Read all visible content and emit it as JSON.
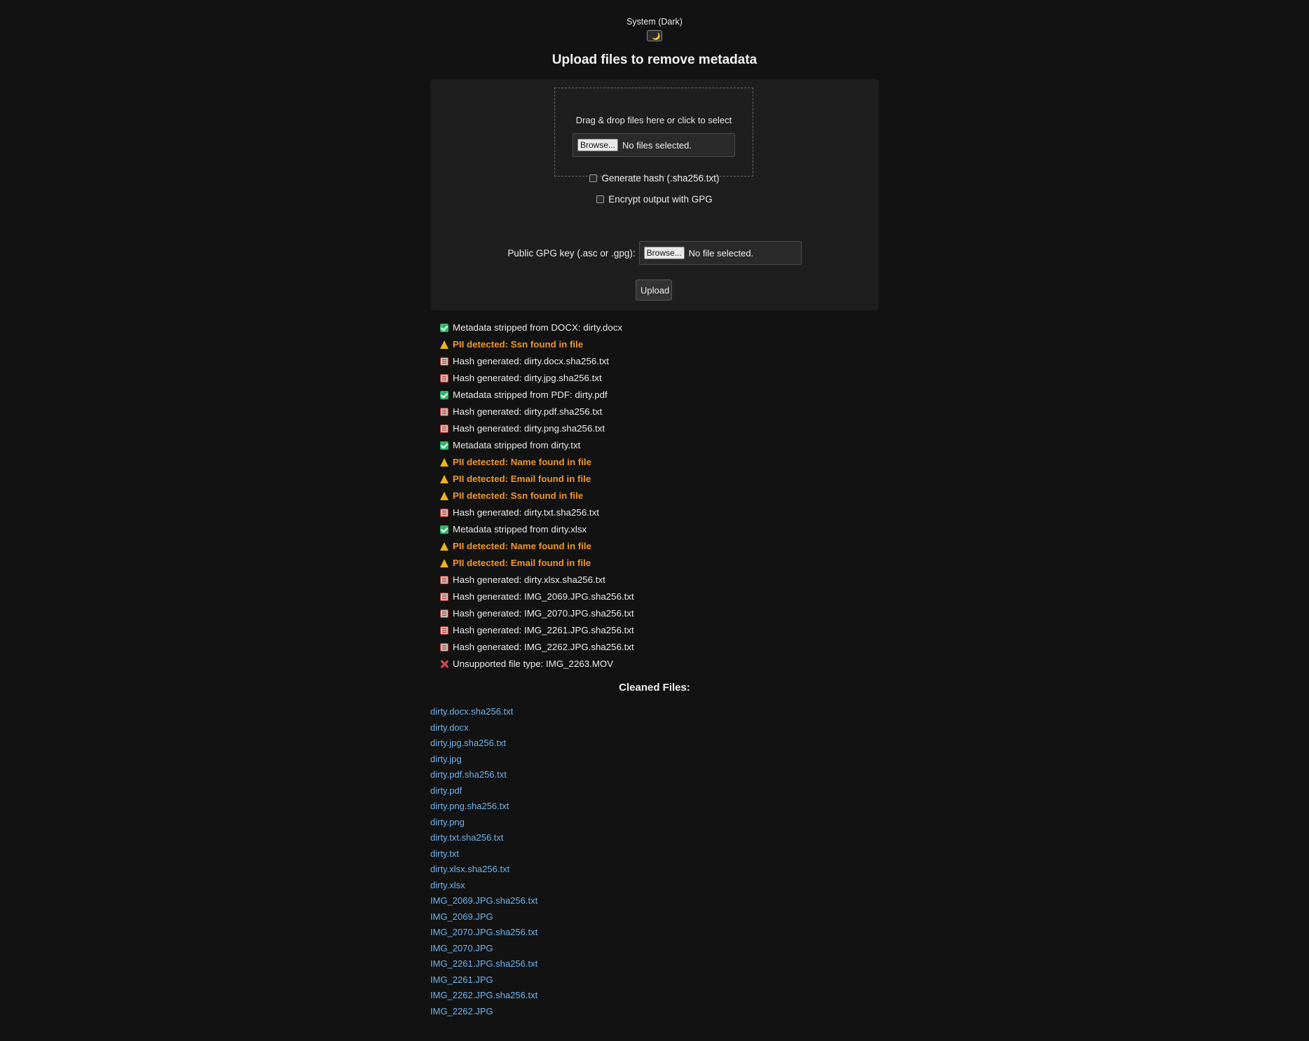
{
  "theme": {
    "label": "System (Dark)",
    "toggle_glyph": "🌙"
  },
  "title": "Upload files to remove metadata",
  "dropzone": {
    "text": "Drag & drop files here or click to select",
    "browse_label": "Browse...",
    "status": "No files selected."
  },
  "options": {
    "hash_label": "Generate hash (.sha256.txt)",
    "encrypt_label": "Encrypt output with GPG"
  },
  "gpg": {
    "label": "Public GPG key (.asc or .gpg):",
    "browse_label": "Browse...",
    "status": "No file selected."
  },
  "upload_label": "Upload",
  "log": [
    {
      "type": "ok",
      "icon": "check-icon",
      "text": "Metadata stripped from DOCX: dirty.docx"
    },
    {
      "type": "warn",
      "icon": "warning-icon",
      "text": "PII detected: Ssn found in file"
    },
    {
      "type": "hash",
      "icon": "hash-icon",
      "text": "Hash generated: dirty.docx.sha256.txt"
    },
    {
      "type": "hash",
      "icon": "hash-icon",
      "text": "Hash generated: dirty.jpg.sha256.txt"
    },
    {
      "type": "ok",
      "icon": "check-icon",
      "text": "Metadata stripped from PDF: dirty.pdf"
    },
    {
      "type": "hash",
      "icon": "hash-icon",
      "text": "Hash generated: dirty.pdf.sha256.txt"
    },
    {
      "type": "hash",
      "icon": "hash-icon",
      "text": "Hash generated: dirty.png.sha256.txt"
    },
    {
      "type": "ok",
      "icon": "check-icon",
      "text": "Metadata stripped from dirty.txt"
    },
    {
      "type": "warn",
      "icon": "warning-icon",
      "text": "PII detected: Name found in file"
    },
    {
      "type": "warn",
      "icon": "warning-icon",
      "text": "PII detected: Email found in file"
    },
    {
      "type": "warn",
      "icon": "warning-icon",
      "text": "PII detected: Ssn found in file"
    },
    {
      "type": "hash",
      "icon": "hash-icon",
      "text": "Hash generated: dirty.txt.sha256.txt"
    },
    {
      "type": "ok",
      "icon": "check-icon",
      "text": "Metadata stripped from dirty.xlsx"
    },
    {
      "type": "warn",
      "icon": "warning-icon",
      "text": "PII detected: Name found in file"
    },
    {
      "type": "warn",
      "icon": "warning-icon",
      "text": "PII detected: Email found in file"
    },
    {
      "type": "hash",
      "icon": "hash-icon",
      "text": "Hash generated: dirty.xlsx.sha256.txt"
    },
    {
      "type": "hash",
      "icon": "hash-icon",
      "text": "Hash generated: IMG_2069.JPG.sha256.txt"
    },
    {
      "type": "hash",
      "icon": "hash-icon",
      "text": "Hash generated: IMG_2070.JPG.sha256.txt"
    },
    {
      "type": "hash",
      "icon": "hash-icon",
      "text": "Hash generated: IMG_2261.JPG.sha256.txt"
    },
    {
      "type": "hash",
      "icon": "hash-icon",
      "text": "Hash generated: IMG_2262.JPG.sha256.txt"
    },
    {
      "type": "err",
      "icon": "cross-icon",
      "text": "Unsupported file type: IMG_2263.MOV"
    }
  ],
  "cleaned_heading": "Cleaned Files:",
  "cleaned_files": [
    "dirty.docx.sha256.txt",
    "dirty.docx",
    "dirty.jpg.sha256.txt",
    "dirty.jpg",
    "dirty.pdf.sha256.txt",
    "dirty.pdf",
    "dirty.png.sha256.txt",
    "dirty.png",
    "dirty.txt.sha256.txt",
    "dirty.txt",
    "dirty.xlsx.sha256.txt",
    "dirty.xlsx",
    "IMG_2069.JPG.sha256.txt",
    "IMG_2069.JPG",
    "IMG_2070.JPG.sha256.txt",
    "IMG_2070.JPG",
    "IMG_2261.JPG.sha256.txt",
    "IMG_2261.JPG",
    "IMG_2262.JPG.sha256.txt",
    "IMG_2262.JPG"
  ],
  "colors": {
    "background": "#121212",
    "panel": "#1e1e1e",
    "warning": "#f0962a",
    "link": "#6fb3f0",
    "ok": "#2eb86a",
    "error": "#e8404e"
  }
}
